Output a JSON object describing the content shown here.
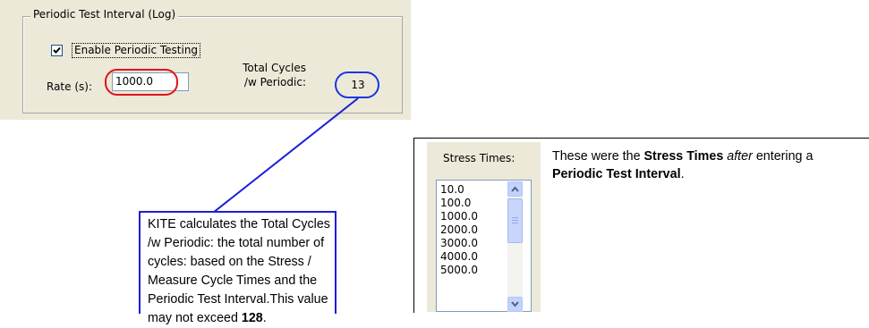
{
  "periodic_panel": {
    "group_title": "Periodic Test Interval (Log)",
    "enable_checkbox": {
      "label": "Enable Periodic Testing",
      "checked": true
    },
    "rate_label": "Rate (s):",
    "rate_value": "1000.0",
    "total_cycles_label_line1": "Total Cycles",
    "total_cycles_label_line2": "/w Periodic:",
    "total_cycles_value": "13",
    "highlight_colors": {
      "rate": "#e0131a",
      "total": "#1837e0"
    }
  },
  "callout_note": {
    "text": "KITE calculates the Total Cycles /w Periodic: the total number of cycles: based on the Stress / Measure Cycle Times and the Periodic Test Interval.This value may not exceed ",
    "limit": "128",
    "end": ".",
    "border_color": "#1a1ed8"
  },
  "stress_times": {
    "title": "Stress Times:",
    "items": [
      "10.0",
      "100.0",
      "1000.0",
      "2000.0",
      "3000.0",
      "4000.0",
      "5000.0"
    ]
  },
  "stress_note": {
    "part1": "These were the ",
    "bold1": "Stress Times",
    "space1": " ",
    "italic1": "after",
    "part2": " entering a ",
    "bold2": "Periodic Test Interval",
    "end": "."
  }
}
